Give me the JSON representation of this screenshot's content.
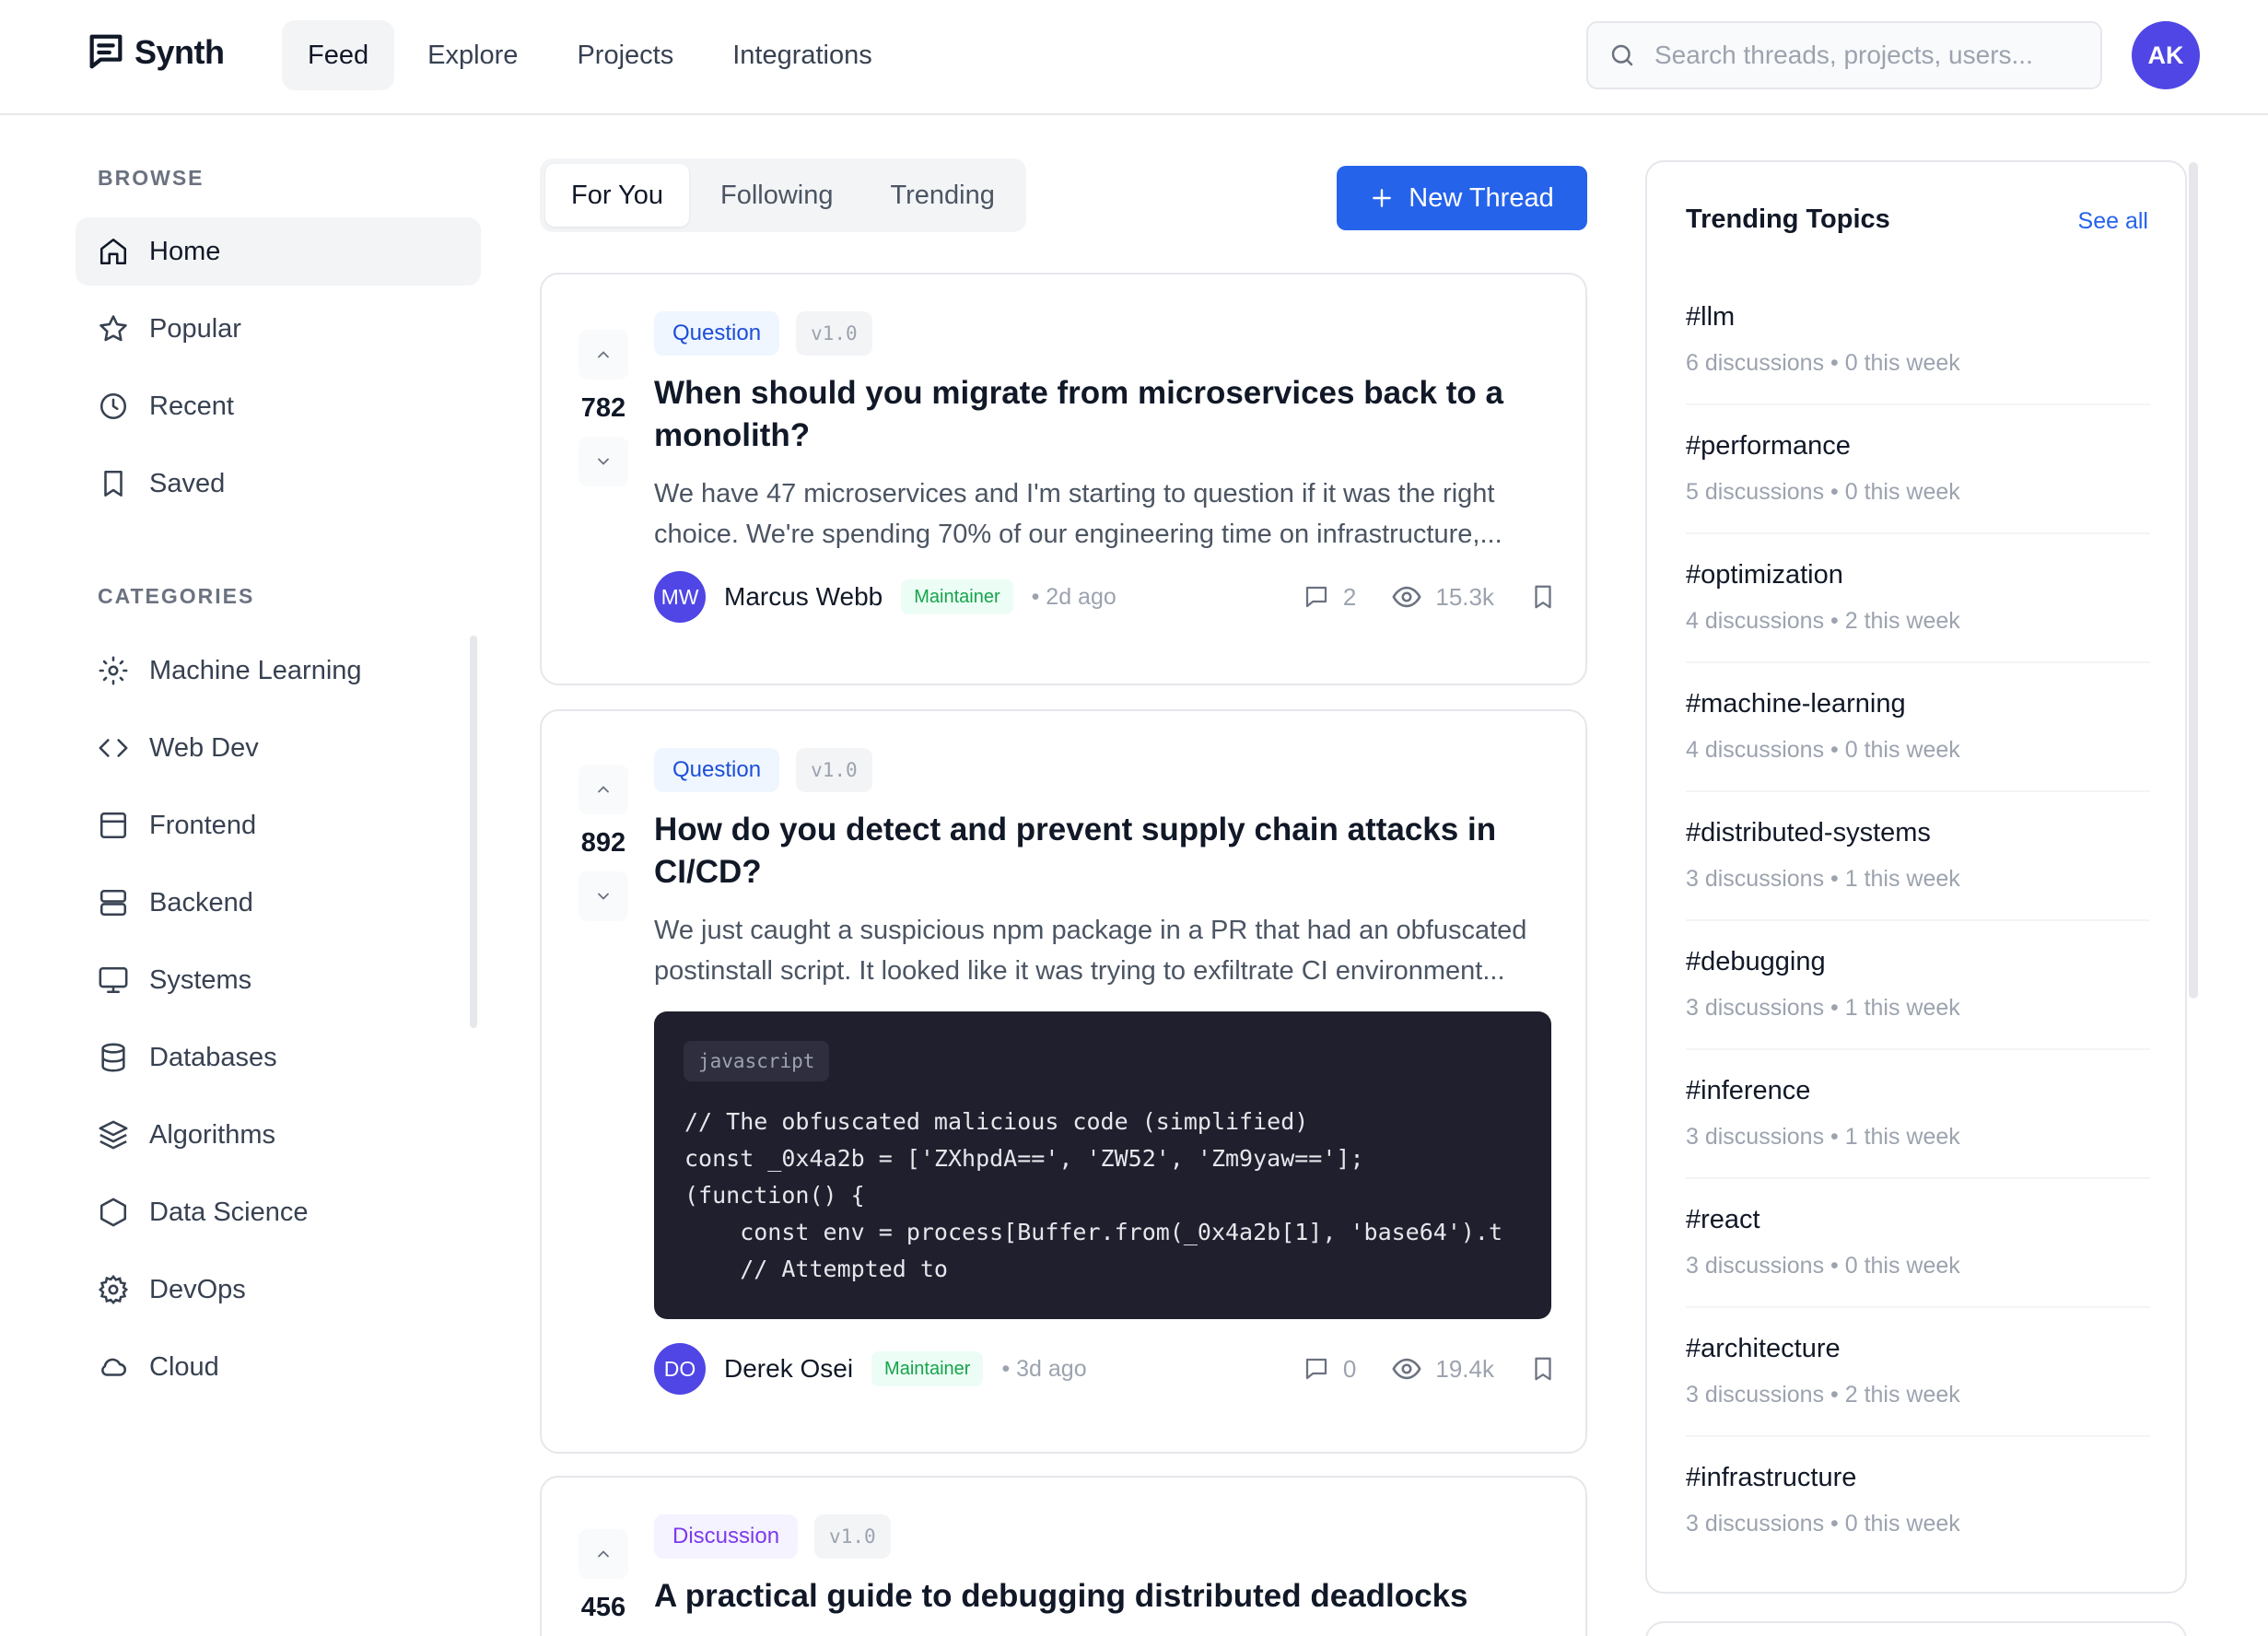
{
  "app": {
    "name": "Synth",
    "user_initials": "AK"
  },
  "nav": {
    "tabs": [
      {
        "label": "Feed"
      },
      {
        "label": "Explore"
      },
      {
        "label": "Projects"
      },
      {
        "label": "Integrations"
      }
    ],
    "active": "Feed"
  },
  "search": {
    "placeholder": "Search threads, projects, users..."
  },
  "sidebar": {
    "browse_title": "BROWSE",
    "browse": [
      {
        "label": "Home",
        "icon": "home-icon"
      },
      {
        "label": "Popular",
        "icon": "star-icon"
      },
      {
        "label": "Recent",
        "icon": "clock-icon"
      },
      {
        "label": "Saved",
        "icon": "bookmark-icon"
      }
    ],
    "categories_title": "CATEGORIES",
    "categories": [
      {
        "label": "Machine Learning",
        "icon": "sparkle-icon"
      },
      {
        "label": "Web Dev",
        "icon": "code-icon"
      },
      {
        "label": "Frontend",
        "icon": "layout-icon"
      },
      {
        "label": "Backend",
        "icon": "server-icon"
      },
      {
        "label": "Systems",
        "icon": "monitor-icon"
      },
      {
        "label": "Databases",
        "icon": "database-icon"
      },
      {
        "label": "Algorithms",
        "icon": "layers-icon"
      },
      {
        "label": "Data Science",
        "icon": "hexagon-icon"
      },
      {
        "label": "DevOps",
        "icon": "gear-icon"
      },
      {
        "label": "Cloud",
        "icon": "cloud-icon"
      }
    ]
  },
  "feed": {
    "tabs": [
      {
        "label": "For You"
      },
      {
        "label": "Following"
      },
      {
        "label": "Trending"
      }
    ],
    "new_thread_label": "New Thread",
    "threads": [
      {
        "votes": "782",
        "type": "Question",
        "version": "v1.0",
        "title": "When should you migrate from microservices back to a monolith?",
        "excerpt": "We have 47 microservices and I'm starting to question if it was the right choice. We're spending 70% of our engineering time on infrastructure,...",
        "author": "Marcus Webb",
        "author_initials": "MW",
        "role": "Maintainer",
        "time": "• 2d ago",
        "comments": "2",
        "views": "15.3k"
      },
      {
        "votes": "892",
        "type": "Question",
        "version": "v1.0",
        "title": "How do you detect and prevent supply chain attacks in CI/CD?",
        "excerpt": "We just caught a suspicious npm package in a PR that had an obfuscated postinstall script. It looked like it was trying to exfiltrate CI environment...",
        "code_lang": "javascript",
        "code": "// The obfuscated malicious code (simplified)\nconst _0x4a2b = ['ZXhpdA==', 'ZW52', 'Zm9yaw=='];\n(function() {\n    const env = process[Buffer.from(_0x4a2b[1], 'base64').t\n    // Attempted to",
        "author": "Derek Osei",
        "author_initials": "DO",
        "role": "Maintainer",
        "time": "• 3d ago",
        "comments": "0",
        "views": "19.4k"
      },
      {
        "votes": "456",
        "type": "Discussion",
        "version": "v1.0",
        "title": "A practical guide to debugging distributed deadlocks"
      }
    ]
  },
  "trending": {
    "title": "Trending Topics",
    "see_all": "See all",
    "topics": [
      {
        "name": "#llm",
        "discussions": "6 discussions",
        "week": "0 this week"
      },
      {
        "name": "#performance",
        "discussions": "5 discussions",
        "week": "0 this week"
      },
      {
        "name": "#optimization",
        "discussions": "4 discussions",
        "week": "2 this week"
      },
      {
        "name": "#machine-learning",
        "discussions": "4 discussions",
        "week": "0 this week"
      },
      {
        "name": "#distributed-systems",
        "discussions": "3 discussions",
        "week": "1 this week"
      },
      {
        "name": "#debugging",
        "discussions": "3 discussions",
        "week": "1 this week"
      },
      {
        "name": "#inference",
        "discussions": "3 discussions",
        "week": "1 this week"
      },
      {
        "name": "#react",
        "discussions": "3 discussions",
        "week": "0 this week"
      },
      {
        "name": "#architecture",
        "discussions": "3 discussions",
        "week": "2 this week"
      },
      {
        "name": "#infrastructure",
        "discussions": "3 discussions",
        "week": "0 this week"
      }
    ]
  },
  "colors": {
    "accent": "#2563eb",
    "avatar": "#4f46e5",
    "maintainer": "#16a34a",
    "code_bg": "#1f1f2e"
  }
}
